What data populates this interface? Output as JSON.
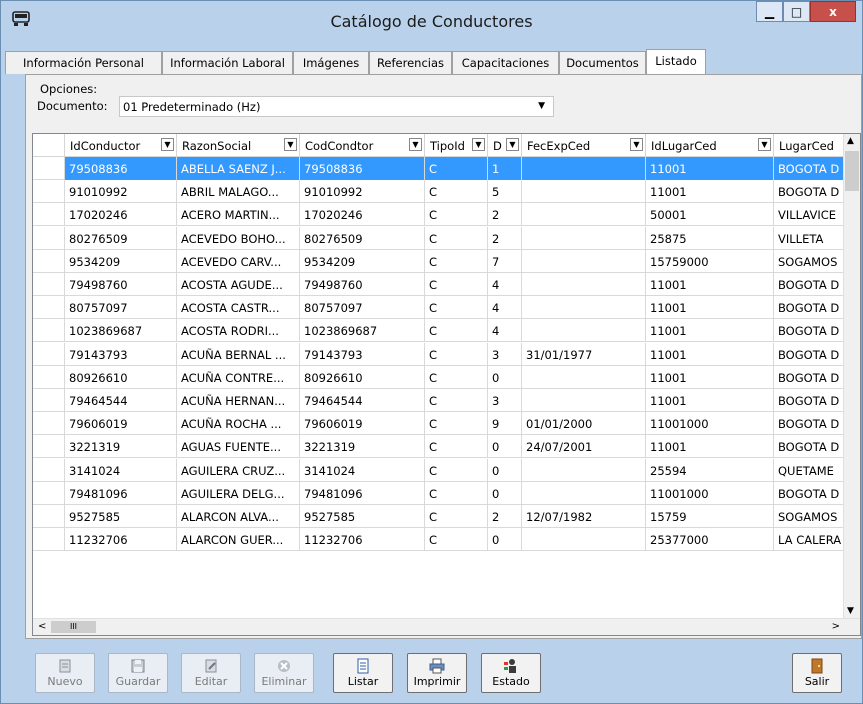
{
  "window": {
    "title": "Catálogo de Conductores",
    "minimize": "▁",
    "maximize": "□",
    "close": "x"
  },
  "tabs": [
    {
      "label": "Información Personal",
      "active": false
    },
    {
      "label": "Información Laboral",
      "active": false
    },
    {
      "label": "Imágenes",
      "active": false
    },
    {
      "label": "Referencias",
      "active": false
    },
    {
      "label": "Capacitaciones",
      "active": false
    },
    {
      "label": "Documentos",
      "active": false
    },
    {
      "label": "Listado",
      "active": true
    }
  ],
  "options": {
    "label": "Opciones:",
    "document_label": "Documento:",
    "document_value": "01 Predeterminado (Hz)"
  },
  "grid": {
    "columns": [
      "IdConductor",
      "RazonSocial",
      "CodCondtor",
      "TipoId",
      "D",
      "FecExpCed",
      "IdLugarCed",
      "LugarCed"
    ],
    "rows": [
      [
        "79508836",
        "ABELLA SAENZ J...",
        "79508836",
        "C",
        "1",
        "",
        "11001",
        "BOGOTA D"
      ],
      [
        "91010992",
        "ABRIL MALAGO...",
        "91010992",
        "C",
        "5",
        "",
        "11001",
        "BOGOTA D"
      ],
      [
        "17020246",
        "ACERO MARTIN...",
        "17020246",
        "C",
        "2",
        "",
        "50001",
        "VILLAVICE"
      ],
      [
        "80276509",
        "ACEVEDO BOHO...",
        "80276509",
        "C",
        "2",
        "",
        "25875",
        "VILLETA"
      ],
      [
        "9534209",
        "ACEVEDO CARV...",
        "9534209",
        "C",
        "7",
        "",
        "15759000",
        "SOGAMOS"
      ],
      [
        "79498760",
        "ACOSTA AGUDE...",
        "79498760",
        "C",
        "4",
        "",
        "11001",
        "BOGOTA D"
      ],
      [
        "80757097",
        "ACOSTA CASTR...",
        "80757097",
        "C",
        "4",
        "",
        "11001",
        "BOGOTA D"
      ],
      [
        "1023869687",
        "ACOSTA RODRI...",
        "1023869687",
        "C",
        "4",
        "",
        "11001",
        "BOGOTA D"
      ],
      [
        "79143793",
        "ACUÑA BERNAL ...",
        "79143793",
        "C",
        "3",
        "31/01/1977",
        "11001",
        "BOGOTA D"
      ],
      [
        "80926610",
        "ACUÑA CONTRE...",
        "80926610",
        "C",
        "0",
        "",
        "11001",
        "BOGOTA D"
      ],
      [
        "79464544",
        "ACUÑA HERNAN...",
        "79464544",
        "C",
        "3",
        "",
        "11001",
        "BOGOTA D"
      ],
      [
        "79606019",
        "ACUÑA ROCHA ...",
        "79606019",
        "C",
        "9",
        "01/01/2000",
        "11001000",
        "BOGOTA D"
      ],
      [
        "3221319",
        "AGUAS FUENTE...",
        "3221319",
        "C",
        "0",
        "24/07/2001",
        "11001",
        "BOGOTA D"
      ],
      [
        "3141024",
        "AGUILERA CRUZ...",
        "3141024",
        "C",
        "0",
        "",
        "25594",
        "QUETAME"
      ],
      [
        "79481096",
        "AGUILERA DELG...",
        "79481096",
        "C",
        "0",
        "",
        "11001000",
        "BOGOTA D"
      ],
      [
        "9527585",
        "ALARCON ALVA...",
        "9527585",
        "C",
        "2",
        "12/07/1982",
        "15759",
        "SOGAMOS"
      ],
      [
        "11232706",
        "ALARCON GUER...",
        "11232706",
        "C",
        "0",
        "",
        "25377000",
        "LA CALERA"
      ]
    ],
    "selected_row": 0
  },
  "toolbar": [
    {
      "label": "Nuevo",
      "enabled": false,
      "icon": "new-icon"
    },
    {
      "label": "Guardar",
      "enabled": false,
      "icon": "save-icon"
    },
    {
      "label": "Editar",
      "enabled": false,
      "icon": "edit-icon"
    },
    {
      "label": "Eliminar",
      "enabled": false,
      "icon": "delete-icon"
    },
    {
      "label": "Listar",
      "enabled": true,
      "icon": "list-icon"
    },
    {
      "label": "Imprimir",
      "enabled": true,
      "icon": "print-icon"
    },
    {
      "label": "Estado",
      "enabled": true,
      "icon": "status-icon"
    },
    {
      "label": "Salir",
      "enabled": true,
      "icon": "exit-icon"
    }
  ],
  "colors": {
    "window_bg": "#b9d1ea",
    "selection": "#3399ff",
    "close_button": "#c7504b"
  }
}
